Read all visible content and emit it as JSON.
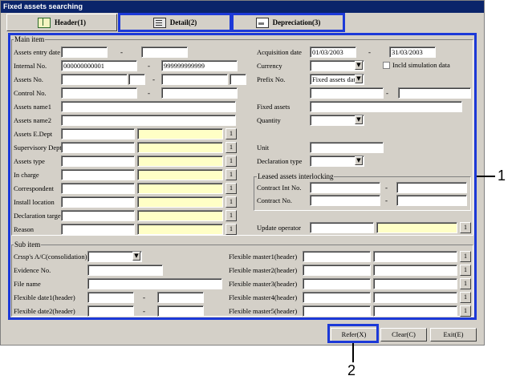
{
  "window": {
    "title": "Fixed assets searching"
  },
  "tabs": [
    {
      "label": "Header(1)",
      "icon": "book-icon"
    },
    {
      "label": "Detail(2)",
      "icon": "document-icon"
    },
    {
      "label": "Depreciation(3)",
      "icon": "picture-icon"
    }
  ],
  "main": {
    "group_label": "Main item",
    "left_rows": [
      {
        "label": "Assets entry date",
        "from": "",
        "to": ""
      },
      {
        "label": "Internal No.",
        "from": "000000000001",
        "to": "999999999999"
      },
      {
        "label": "Assets No.",
        "from": "",
        "to": ""
      },
      {
        "label": "Control No.",
        "from": "",
        "to": ""
      },
      {
        "label": "Assets name1",
        "value": ""
      },
      {
        "label": "Assets name2",
        "value": ""
      }
    ],
    "lookup_rows": [
      {
        "label": "Assets E.Dept",
        "btn": "1"
      },
      {
        "label": "Supervisory Dept",
        "btn": "1"
      },
      {
        "label": "Assets type",
        "btn": "1"
      },
      {
        "label": "In charge",
        "btn": "1"
      },
      {
        "label": "Correspondent",
        "btn": "1"
      },
      {
        "label": "Install location",
        "btn": "1"
      },
      {
        "label": "Declaration target",
        "btn": "1"
      },
      {
        "label": "Reason",
        "btn": "1"
      }
    ],
    "acquisition_date": {
      "label": "Acquisition date",
      "from": "01/03/2003",
      "to": "31/03/2003"
    },
    "currency": {
      "label": "Currency",
      "value": ""
    },
    "incl_simulation": {
      "label": "Incld simulation data",
      "checked": false
    },
    "prefix_no": {
      "label": "Prefix No.",
      "value": "Fixed assets data"
    },
    "fixed_assets": {
      "label": "Fixed assets",
      "value": ""
    },
    "quantity": {
      "label": "Quantity",
      "value": ""
    },
    "unit": {
      "label": "Unit",
      "value": ""
    },
    "declaration_type": {
      "label": "Declaration type",
      "value": ""
    },
    "leased": {
      "group_label": "Leased assets interlocking",
      "contract_int_no": {
        "label": "Contract Int No."
      },
      "contract_no": {
        "label": "Contract No."
      }
    },
    "update_operator": {
      "label": "Update operator",
      "btn": "1"
    },
    "dash": "-"
  },
  "sub": {
    "group_label": "Sub item",
    "crssp": {
      "label": "Crssp's A/C(consolidation)",
      "value": ""
    },
    "evidence": {
      "label": "Evidence No.",
      "value": ""
    },
    "file_name": {
      "label": "File name",
      "value": ""
    },
    "flex_date1": {
      "label": "Flexible date1(header)"
    },
    "flex_date2": {
      "label": "Flexible date2(header)"
    },
    "flex_masters": [
      {
        "label": "Flexible master1(header)",
        "btn": "1"
      },
      {
        "label": "Flexible master2(header)",
        "btn": "1"
      },
      {
        "label": "Flexible master3(header)",
        "btn": "1"
      },
      {
        "label": "Flexible master4(header)",
        "btn": "1"
      },
      {
        "label": "Flexible master5(header)",
        "btn": "1"
      }
    ]
  },
  "buttons": {
    "refer": "Refer(X)",
    "clear": "Clear(C)",
    "exit": "Exit(E)"
  },
  "callouts": {
    "one": "1",
    "two": "2"
  },
  "colors": {
    "highlight": "#1c39d8",
    "titlebar": "#0a246a",
    "lookup_field": "#ffffc6",
    "window": "#d4d0c8"
  }
}
